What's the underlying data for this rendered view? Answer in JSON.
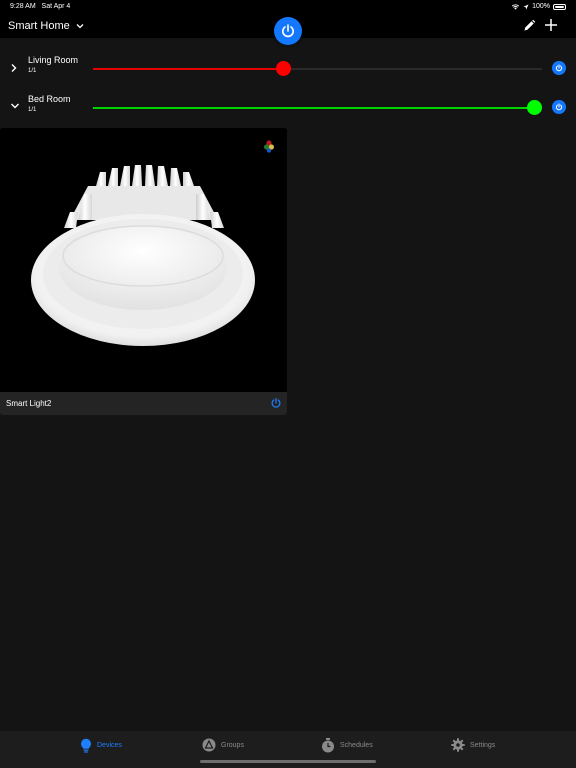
{
  "status_bar": {
    "time": "9:28 AM",
    "date": "Sat Apr 4",
    "battery": "100%"
  },
  "header": {
    "title": "Smart Home"
  },
  "groups": [
    {
      "name": "Living Room",
      "count": "1/1",
      "expanded": false,
      "color": "#ff0000",
      "level": 0.42
    },
    {
      "name": "Bed Room",
      "count": "1/1",
      "expanded": true,
      "color": "#00ff00",
      "level": 1.0
    }
  ],
  "device": {
    "name": "Smart Light2"
  },
  "tabs": [
    {
      "label": "Devices",
      "icon": "bulb-icon",
      "active": true
    },
    {
      "label": "Groups",
      "icon": "groups-icon",
      "active": false
    },
    {
      "label": "Schedules",
      "icon": "clock-icon",
      "active": false
    },
    {
      "label": "Settings",
      "icon": "gear-icon",
      "active": false
    }
  ],
  "colors": {
    "accent": "#1478ff",
    "background": "#141414",
    "card_footer": "#242424"
  }
}
